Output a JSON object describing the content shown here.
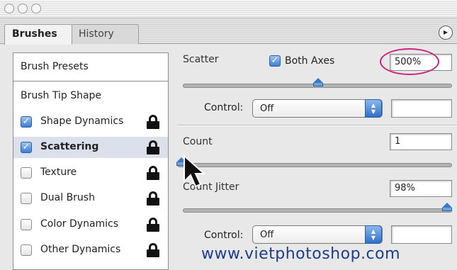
{
  "window": {
    "tabs": [
      {
        "label": "Brushes",
        "active": true
      },
      {
        "label": "History",
        "active": false
      }
    ],
    "menu_icon": "chevron-right-icon"
  },
  "sidebar": {
    "presets_label": "Brush Presets",
    "tip_shape_label": "Brush Tip Shape",
    "items": [
      {
        "label": "Shape Dynamics",
        "checked": true,
        "selected": false
      },
      {
        "label": "Scattering",
        "checked": true,
        "selected": true
      },
      {
        "label": "Texture",
        "checked": false,
        "selected": false
      },
      {
        "label": "Dual Brush",
        "checked": false,
        "selected": false
      },
      {
        "label": "Color Dynamics",
        "checked": false,
        "selected": false
      },
      {
        "label": "Other Dynamics",
        "checked": false,
        "selected": false
      }
    ]
  },
  "scatter": {
    "label": "Scatter",
    "both_axes_label": "Both Axes",
    "both_axes_checked": true,
    "value": "500%",
    "control_label": "Control:",
    "control_value": "Off",
    "control_field": ""
  },
  "count": {
    "label": "Count",
    "value": "1"
  },
  "count_jitter": {
    "label": "Count Jitter",
    "value": "98%",
    "control_label": "Control:",
    "control_value": "Off",
    "control_field": ""
  },
  "watermark": "www.vietphotoshop.com",
  "colors": {
    "accent": "#3a7fd6",
    "highlight": "#d0207a",
    "watermark": "#1e3c8a"
  }
}
